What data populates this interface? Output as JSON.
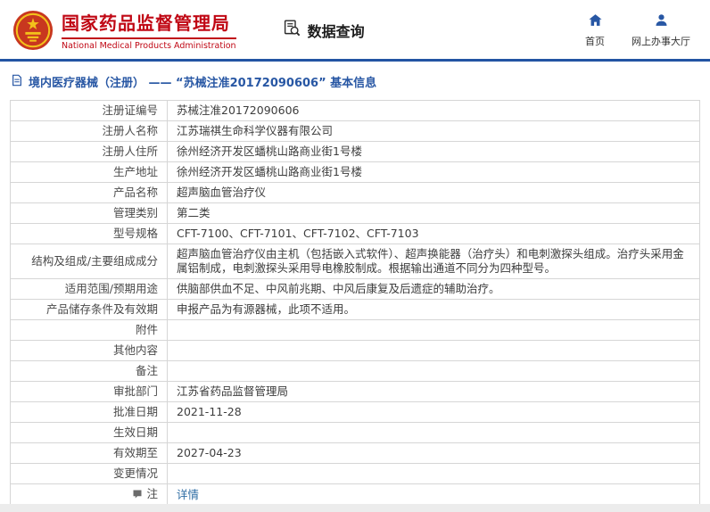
{
  "header": {
    "org_name_cn": "国家药品监督管理局",
    "org_name_en": "National Medical Products Administration",
    "section_title": "数据查询",
    "nav_home": "首页",
    "nav_service_hall": "网上办事大厅"
  },
  "breadcrumb": {
    "text": "境内医疗器械（注册） —— “苏械注准20172090606” 基本信息"
  },
  "table": {
    "rows": [
      {
        "label": "注册证编号",
        "value": "苏械注准20172090606"
      },
      {
        "label": "注册人名称",
        "value": "江苏瑞祺生命科学仪器有限公司"
      },
      {
        "label": "注册人住所",
        "value": "徐州经济开发区蟠桃山路商业街1号楼"
      },
      {
        "label": "生产地址",
        "value": "徐州经济开发区蟠桃山路商业街1号楼"
      },
      {
        "label": "产品名称",
        "value": "超声脑血管治疗仪"
      },
      {
        "label": "管理类别",
        "value": "第二类"
      },
      {
        "label": "型号规格",
        "value": "CFT-7100、CFT-7101、CFT-7102、CFT-7103"
      },
      {
        "label": "结构及组成/主要组成成分",
        "value": "超声脑血管治疗仪由主机（包括嵌入式软件）、超声换能器（治疗头）和电刺激探头组成。治疗头采用金属铝制成，电刺激探头采用导电橡胶制成。根据输出通道不同分为四种型号。"
      },
      {
        "label": "适用范围/预期用途",
        "value": "供脑部供血不足、中风前兆期、中风后康复及后遗症的辅助治疗。"
      },
      {
        "label": "产品储存条件及有效期",
        "value": "申报产品为有源器械，此项不适用。"
      },
      {
        "label": "附件",
        "value": ""
      },
      {
        "label": "其他内容",
        "value": ""
      },
      {
        "label": "备注",
        "value": ""
      },
      {
        "label": "审批部门",
        "value": "江苏省药品监督管理局"
      },
      {
        "label": "批准日期",
        "value": "2021-11-28"
      },
      {
        "label": "生效日期",
        "value": ""
      },
      {
        "label": "有效期至",
        "value": "2027-04-23"
      },
      {
        "label": "变更情况",
        "value": ""
      },
      {
        "label": "注",
        "value_link": "详情"
      }
    ]
  },
  "colors": {
    "brand_red": "#c00714",
    "brand_blue": "#2254a3",
    "nav_icon_blue": "#2857a4",
    "link_blue": "#2e6da4",
    "table_border": "#d6d6d6"
  }
}
